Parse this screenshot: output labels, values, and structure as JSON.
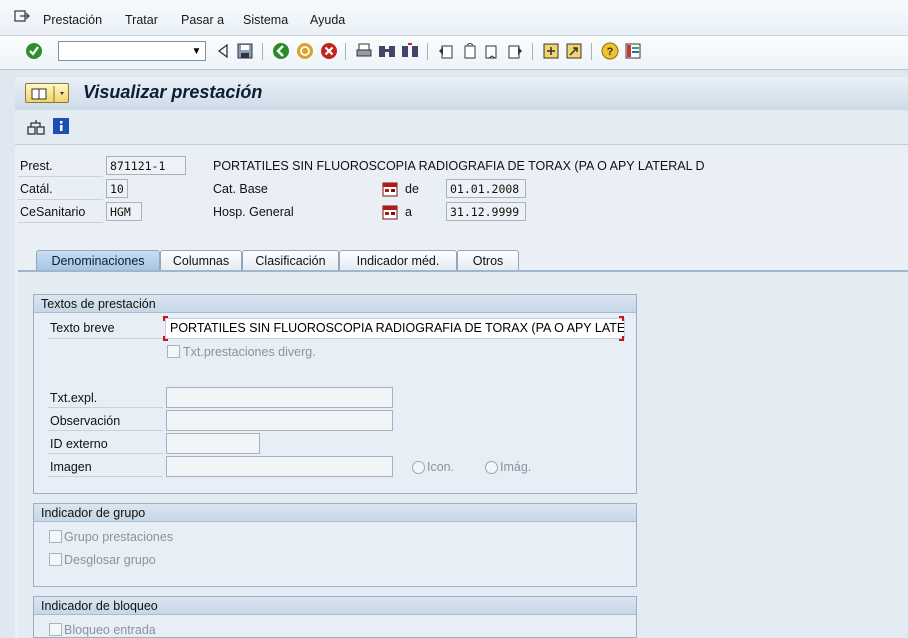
{
  "menu": {
    "items": [
      {
        "label": "Prestación"
      },
      {
        "label": "Tratar"
      },
      {
        "label": "Pasar a"
      },
      {
        "label": "Sistema"
      },
      {
        "label": "Ayuda"
      }
    ]
  },
  "toolbar": {
    "command_value": ""
  },
  "title": "Visualizar prestación",
  "header_fields": {
    "prest_label": "Prest.",
    "prest_value": "871121-1",
    "prest_desc": "PORTATILES SIN FLUOROSCOPIA RADIOGRAFIA DE TORAX (PA O APY LATERAL D",
    "catal_label": "Catál.",
    "catal_value": "10",
    "catal_desc": "Cat. Base",
    "cesanitario_label": "CeSanitario",
    "cesanitario_value": "HGM",
    "cesanitario_desc": "Hosp. General",
    "de_label": "de",
    "de_value": "01.01.2008",
    "a_label": "a",
    "a_value": "31.12.9999"
  },
  "tabs": [
    {
      "label": "Denominaciones",
      "active": true
    },
    {
      "label": "Columnas",
      "active": false
    },
    {
      "label": "Clasificación",
      "active": false
    },
    {
      "label": "Indicador méd.",
      "active": false
    },
    {
      "label": "Otros",
      "active": false
    }
  ],
  "textos_group": {
    "title": "Textos de prestación",
    "texto_breve_label": "Texto breve",
    "texto_breve_value": "PORTATILES SIN FLUOROSCOPIA RADIOGRAFIA DE TORAX (PA O APY LATERAL D",
    "txt_diverg_label": "Txt.prestaciones diverg.",
    "txt_expl_label": "Txt.expl.",
    "observacion_label": "Observación",
    "id_externo_label": "ID externo",
    "imagen_label": "Imagen",
    "icon_radio_label": "Icon.",
    "imag_radio_label": "Imág."
  },
  "grupo_group": {
    "title": "Indicador de grupo",
    "grupo_prestaciones_label": "Grupo prestaciones",
    "desglosar_grupo_label": "Desglosar grupo"
  },
  "bloqueo_group": {
    "title": "Indicador de bloqueo",
    "bloqueo_entrada_label": "Bloqueo entrada"
  }
}
